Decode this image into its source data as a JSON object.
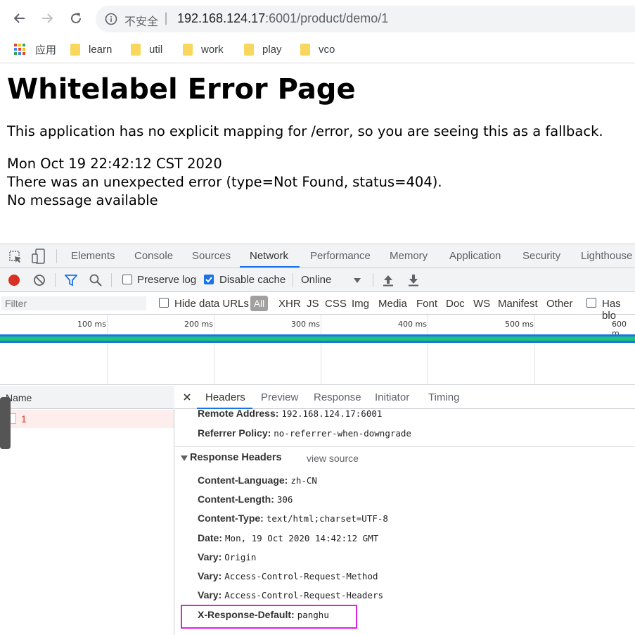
{
  "browser": {
    "security_label": "不安全",
    "url_host": "192.168.124.17",
    "url_path": ":6001/product/demo/1",
    "bookmarks": [
      {
        "label": "应用",
        "icon": "apps-grid-icon"
      },
      {
        "label": "learn",
        "icon": "folder-icon"
      },
      {
        "label": "util",
        "icon": "folder-icon"
      },
      {
        "label": "work",
        "icon": "folder-icon"
      },
      {
        "label": "play",
        "icon": "folder-icon"
      },
      {
        "label": "vco",
        "icon": "folder-icon"
      }
    ]
  },
  "page": {
    "title": "Whitelabel Error Page",
    "fallback_text": "This application has no explicit mapping for /error, so you are seeing this as a fallback.",
    "timestamp": "Mon Oct 19 22:42:12 CST 2020",
    "error_line": "There was an unexpected error (type=Not Found, status=404).",
    "message_line": "No message available"
  },
  "devtools": {
    "tabs": [
      "Elements",
      "Console",
      "Sources",
      "Network",
      "Performance",
      "Memory",
      "Application",
      "Security",
      "Lighthouse"
    ],
    "active_tab": "Network",
    "toolbar": {
      "preserve_log": "Preserve log",
      "disable_cache": "Disable cache",
      "throttle": "Online"
    },
    "filter": {
      "placeholder": "Filter",
      "hide_data_urls": "Hide data URLs",
      "types": [
        "All",
        "XHR",
        "JS",
        "CSS",
        "Img",
        "Media",
        "Font",
        "Doc",
        "WS",
        "Manifest",
        "Other"
      ],
      "has_blocked": "Has blo"
    },
    "timeline_ticks": [
      "100 ms",
      "200 ms",
      "300 ms",
      "400 ms",
      "500 ms",
      "600 m"
    ],
    "list": {
      "header": "Name",
      "rows": [
        {
          "name": "1"
        }
      ]
    },
    "detail_tabs": [
      "Headers",
      "Preview",
      "Response",
      "Initiator",
      "Timing"
    ],
    "general": [
      {
        "key": "Remote Address:",
        "value": "192.168.124.17:6001"
      },
      {
        "key": "Referrer Policy:",
        "value": "no-referrer-when-downgrade"
      }
    ],
    "response_headers_title": "Response Headers",
    "view_source": "view source",
    "response_headers": [
      {
        "key": "Content-Language:",
        "value": "zh-CN"
      },
      {
        "key": "Content-Length:",
        "value": "306"
      },
      {
        "key": "Content-Type:",
        "value": "text/html;charset=UTF-8"
      },
      {
        "key": "Date:",
        "value": "Mon, 19 Oct 2020 14:42:12 GMT"
      },
      {
        "key": "Vary:",
        "value": "Origin"
      },
      {
        "key": "Vary:",
        "value": "Access-Control-Request-Method"
      },
      {
        "key": "Vary:",
        "value": "Access-Control-Request-Headers"
      },
      {
        "key": "X-Response-Default:",
        "value": "panghu"
      }
    ],
    "colors": {
      "accent": "#1a73e8",
      "error_row": "#d93025",
      "highlight_box": "#e020e0",
      "timeline_green": "#1dc47b"
    }
  }
}
